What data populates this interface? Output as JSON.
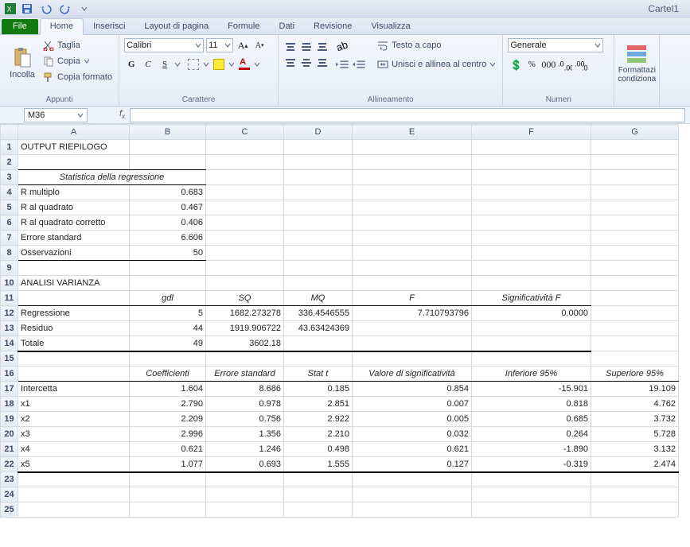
{
  "title": "Cartel1",
  "tabs": {
    "file": "File",
    "items": [
      "Home",
      "Inserisci",
      "Layout di pagina",
      "Formule",
      "Dati",
      "Revisione",
      "Visualizza"
    ],
    "active": 0
  },
  "ribbon": {
    "clipboard": {
      "paste": "Incolla",
      "cut": "Taglia",
      "copy": "Copia",
      "format_painter": "Copia formato",
      "label": "Appunti"
    },
    "font": {
      "name": "Calibri",
      "size": "11",
      "label": "Carattere"
    },
    "alignment": {
      "wrap": "Testo a capo",
      "merge": "Unisci e allinea al centro",
      "label": "Allineamento"
    },
    "number": {
      "format": "Generale",
      "label": "Numeri"
    },
    "styles": {
      "cond": "Formattazi\ncondiziona"
    }
  },
  "namebox": "M36",
  "columns": [
    "A",
    "B",
    "C",
    "D",
    "E",
    "F",
    "G"
  ],
  "cells": {
    "r1": {
      "A": "OUTPUT RIEPILOGO"
    },
    "r3": {
      "A": "Statistica della regressione"
    },
    "r4": {
      "A": "R multiplo",
      "B": "0.683"
    },
    "r5": {
      "A": "R al quadrato",
      "B": "0.467"
    },
    "r6": {
      "A": "R al quadrato corretto",
      "B": "0.406"
    },
    "r7": {
      "A": "Errore standard",
      "B": "6.606"
    },
    "r8": {
      "A": "Osservazioni",
      "B": "50"
    },
    "r10": {
      "A": "ANALISI VARIANZA"
    },
    "r11": {
      "B": "gdl",
      "C": "SQ",
      "D": "MQ",
      "E": "F",
      "F": "Significatività F"
    },
    "r12": {
      "A": "Regressione",
      "B": "5",
      "C": "1682.273278",
      "D": "336.4546555",
      "E": "7.710793796",
      "F": "0.0000"
    },
    "r13": {
      "A": "Residuo",
      "B": "44",
      "C": "1919.906722",
      "D": "43.63424369"
    },
    "r14": {
      "A": "Totale",
      "B": "49",
      "C": "3602.18"
    },
    "r16": {
      "B": "Coefficienti",
      "C": "Errore standard",
      "D": "Stat t",
      "E": "Valore di significatività",
      "F": "Inferiore 95%",
      "G": "Superiore 95%"
    },
    "r17": {
      "A": "Intercetta",
      "B": "1.604",
      "C": "8.686",
      "D": "0.185",
      "E": "0.854",
      "F": "-15.901",
      "G": "19.109"
    },
    "r18": {
      "A": "x1",
      "B": "2.790",
      "C": "0.978",
      "D": "2.851",
      "E": "0.007",
      "F": "0.818",
      "G": "4.762"
    },
    "r19": {
      "A": "x2",
      "B": "2.209",
      "C": "0.756",
      "D": "2.922",
      "E": "0.005",
      "F": "0.685",
      "G": "3.732"
    },
    "r20": {
      "A": "x3",
      "B": "2.996",
      "C": "1.356",
      "D": "2.210",
      "E": "0.032",
      "F": "0.264",
      "G": "5.728"
    },
    "r21": {
      "A": "x4",
      "B": "0.621",
      "C": "1.246",
      "D": "0.498",
      "E": "0.621",
      "F": "-1.890",
      "G": "3.132"
    },
    "r22": {
      "A": "x5",
      "B": "1.077",
      "C": "0.693",
      "D": "1.555",
      "E": "0.127",
      "F": "-0.319",
      "G": "2.474"
    }
  },
  "chart_data": {
    "type": "table",
    "title": "OUTPUT RIEPILOGO",
    "regression_stats": {
      "R multiplo": 0.683,
      "R al quadrato": 0.467,
      "R al quadrato corretto": 0.406,
      "Errore standard": 6.606,
      "Osservazioni": 50
    },
    "anova": {
      "columns": [
        "gdl",
        "SQ",
        "MQ",
        "F",
        "Significatività F"
      ],
      "rows": [
        {
          "name": "Regressione",
          "gdl": 5,
          "SQ": 1682.273278,
          "MQ": 336.4546555,
          "F": 7.710793796,
          "SigF": 0.0
        },
        {
          "name": "Residuo",
          "gdl": 44,
          "SQ": 1919.906722,
          "MQ": 43.63424369
        },
        {
          "name": "Totale",
          "gdl": 49,
          "SQ": 3602.18
        }
      ]
    },
    "coefficients": {
      "columns": [
        "Coefficienti",
        "Errore standard",
        "Stat t",
        "Valore di significatività",
        "Inferiore 95%",
        "Superiore 95%"
      ],
      "rows": [
        {
          "name": "Intercetta",
          "coef": 1.604,
          "se": 8.686,
          "t": 0.185,
          "p": 0.854,
          "lo": -15.901,
          "hi": 19.109
        },
        {
          "name": "x1",
          "coef": 2.79,
          "se": 0.978,
          "t": 2.851,
          "p": 0.007,
          "lo": 0.818,
          "hi": 4.762
        },
        {
          "name": "x2",
          "coef": 2.209,
          "se": 0.756,
          "t": 2.922,
          "p": 0.005,
          "lo": 0.685,
          "hi": 3.732
        },
        {
          "name": "x3",
          "coef": 2.996,
          "se": 1.356,
          "t": 2.21,
          "p": 0.032,
          "lo": 0.264,
          "hi": 5.728
        },
        {
          "name": "x4",
          "coef": 0.621,
          "se": 1.246,
          "t": 0.498,
          "p": 0.621,
          "lo": -1.89,
          "hi": 3.132
        },
        {
          "name": "x5",
          "coef": 1.077,
          "se": 0.693,
          "t": 1.555,
          "p": 0.127,
          "lo": -0.319,
          "hi": 2.474
        }
      ]
    }
  }
}
